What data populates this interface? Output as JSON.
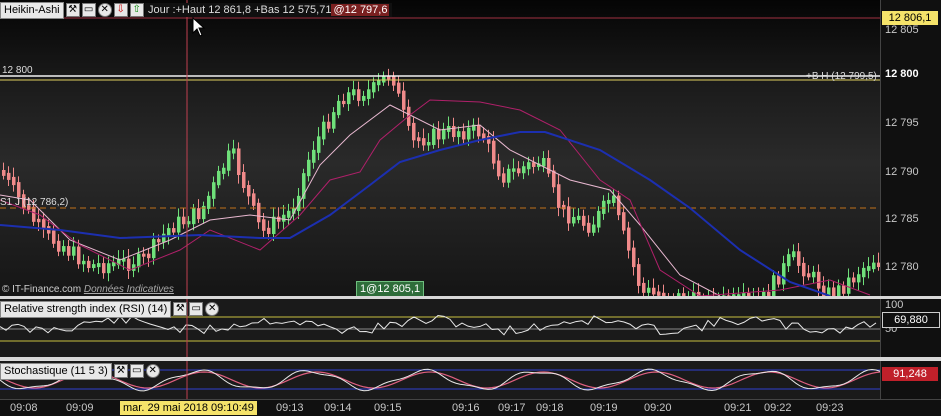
{
  "main": {
    "title": "Heikin-Ashi",
    "info": "Jour :+Haut 12 861,8 +Bas 12 575,71",
    "info_highlight": "@12 797,6",
    "current_price": "12 806,1",
    "level_left": "12 800",
    "level_right": "+B H (12 799,5)",
    "level_orange": "S1 J (12 786,2)",
    "order_label": "1@12 805,1",
    "credit": "© IT-Finance.com",
    "credit_sub": "Données Indicatives",
    "price_ticks": [
      "12 805",
      "12 800",
      "12 795",
      "12 790",
      "12 785",
      "12 780"
    ],
    "price_tick_bold": "12 800"
  },
  "rsi": {
    "title": "Relative strength index (RSI) (14)",
    "value": "69,880",
    "ticks": [
      "100",
      "50"
    ]
  },
  "stoch": {
    "title": "Stochastique (11 5 3)",
    "value": "91,248"
  },
  "time_axis": {
    "labels": [
      "09:08",
      "09:09",
      "09:13",
      "09:14",
      "09:15",
      "09:16",
      "09:17",
      "09:18",
      "09:19",
      "09:20",
      "09:21",
      "09:22",
      "09:23"
    ],
    "cursor_date": "mar. 29 mai 2018 09:10:49"
  },
  "icons": {
    "wrench": "wrench-icon",
    "window": "window-icon",
    "close": "close-icon",
    "down": "red-arrow-down-icon",
    "up": "green-arrow-up-icon"
  },
  "colors": {
    "bull": "#6fe07a",
    "bear": "#f08a8a",
    "ma_blue": "#1c2fb0",
    "ma_magenta": "#b0206a",
    "ma_pink": "#e8b8d0",
    "price_badge": "#f5e36a",
    "stoch_badge": "#c0202a"
  }
}
